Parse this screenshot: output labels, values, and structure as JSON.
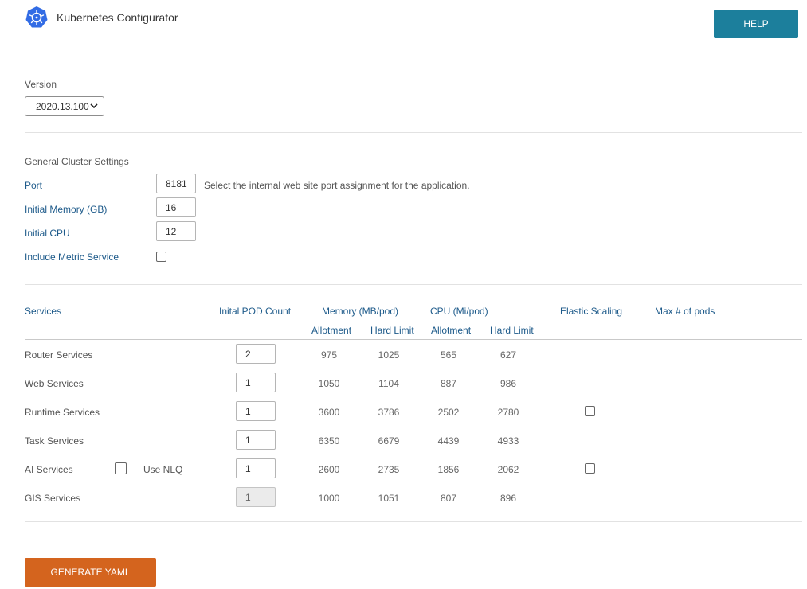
{
  "header": {
    "logo_icon": "kubernetes-helm-icon",
    "title": "Kubernetes Configurator",
    "help_label": "HELP"
  },
  "version": {
    "label": "Version",
    "selected": "2020.13.100"
  },
  "general": {
    "title": "General Cluster Settings",
    "port_label": "Port",
    "port_value": "8181",
    "port_hint": "Select the internal web site port assignment for the application.",
    "memory_label": "Initial Memory (GB)",
    "memory_value": "16",
    "cpu_label": "Initial CPU",
    "cpu_value": "12",
    "metric_label": "Include Metric Service",
    "metric_checked": false
  },
  "services": {
    "headers": {
      "services": "Services",
      "pod_count": "Inital POD Count",
      "memory": "Memory (MB/pod)",
      "cpu": "CPU (Mi/pod)",
      "elastic": "Elastic Scaling",
      "max_pods": "Max # of pods",
      "mem_allot": "Allotment",
      "mem_hard": "Hard Limit",
      "cpu_allot": "Allotment",
      "cpu_hard": "Hard Limit"
    },
    "rows": [
      {
        "name": "Router Services",
        "count": "2",
        "mem_allot": "975",
        "mem_hard": "1025",
        "cpu_allot": "565",
        "cpu_hard": "627"
      },
      {
        "name": "Web Services",
        "count": "1",
        "mem_allot": "1050",
        "mem_hard": "1104",
        "cpu_allot": "887",
        "cpu_hard": "986"
      },
      {
        "name": "Runtime Services",
        "count": "1",
        "mem_allot": "3600",
        "mem_hard": "3786",
        "cpu_allot": "2502",
        "cpu_hard": "2780"
      },
      {
        "name": "Task Services",
        "count": "1",
        "mem_allot": "6350",
        "mem_hard": "6679",
        "cpu_allot": "4439",
        "cpu_hard": "4933"
      },
      {
        "name": "AI Services",
        "count": "1",
        "mem_allot": "2600",
        "mem_hard": "2735",
        "cpu_allot": "1856",
        "cpu_hard": "2062",
        "nlq_label": "Use NLQ"
      },
      {
        "name": "GIS Services",
        "count": "1",
        "mem_allot": "1000",
        "mem_hard": "1051",
        "cpu_allot": "807",
        "cpu_hard": "896"
      }
    ]
  },
  "footer": {
    "generate_label": "GENERATE YAML"
  },
  "colors": {
    "help_button": "#1c7f9c",
    "generate_button": "#d4641e",
    "link_label": "#1d5a8a",
    "k8s_blue": "#326ce5"
  }
}
